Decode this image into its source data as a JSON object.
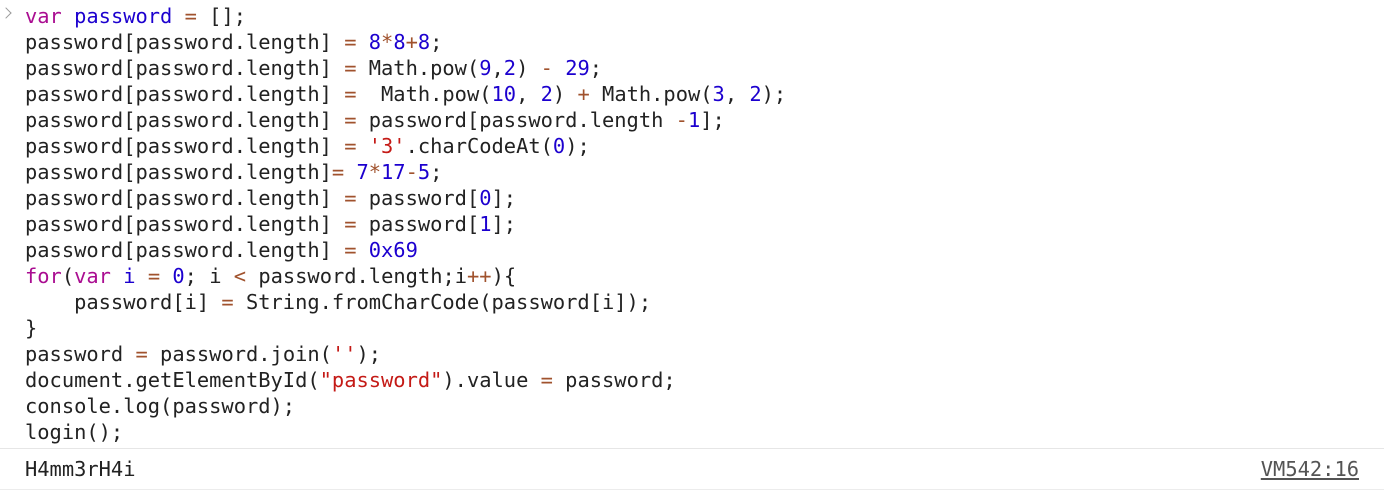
{
  "console": {
    "input": {
      "prompt_icon": "chevron-right-icon",
      "lines": [
        [
          {
            "t": "kw",
            "v": "var"
          },
          {
            "t": "pl",
            "v": " "
          },
          {
            "t": "var",
            "v": "password"
          },
          {
            "t": "pl",
            "v": " "
          },
          {
            "t": "op",
            "v": "="
          },
          {
            "t": "pl",
            "v": " [];"
          }
        ],
        [
          {
            "t": "pl",
            "v": "password[password.length] "
          },
          {
            "t": "op",
            "v": "="
          },
          {
            "t": "pl",
            "v": " "
          },
          {
            "t": "num",
            "v": "8"
          },
          {
            "t": "op",
            "v": "*"
          },
          {
            "t": "num",
            "v": "8"
          },
          {
            "t": "op",
            "v": "+"
          },
          {
            "t": "num",
            "v": "8"
          },
          {
            "t": "pl",
            "v": ";"
          }
        ],
        [
          {
            "t": "pl",
            "v": "password[password.length] "
          },
          {
            "t": "op",
            "v": "="
          },
          {
            "t": "pl",
            "v": " Math.pow("
          },
          {
            "t": "num",
            "v": "9"
          },
          {
            "t": "pl",
            "v": ","
          },
          {
            "t": "num",
            "v": "2"
          },
          {
            "t": "pl",
            "v": ") "
          },
          {
            "t": "op",
            "v": "-"
          },
          {
            "t": "pl",
            "v": " "
          },
          {
            "t": "num",
            "v": "29"
          },
          {
            "t": "pl",
            "v": ";"
          }
        ],
        [
          {
            "t": "pl",
            "v": "password[password.length] "
          },
          {
            "t": "op",
            "v": "="
          },
          {
            "t": "pl",
            "v": "  Math.pow("
          },
          {
            "t": "num",
            "v": "10"
          },
          {
            "t": "pl",
            "v": ", "
          },
          {
            "t": "num",
            "v": "2"
          },
          {
            "t": "pl",
            "v": ") "
          },
          {
            "t": "op",
            "v": "+"
          },
          {
            "t": "pl",
            "v": " Math.pow("
          },
          {
            "t": "num",
            "v": "3"
          },
          {
            "t": "pl",
            "v": ", "
          },
          {
            "t": "num",
            "v": "2"
          },
          {
            "t": "pl",
            "v": ");"
          }
        ],
        [
          {
            "t": "pl",
            "v": "password[password.length] "
          },
          {
            "t": "op",
            "v": "="
          },
          {
            "t": "pl",
            "v": " password[password.length "
          },
          {
            "t": "op",
            "v": "-"
          },
          {
            "t": "num",
            "v": "1"
          },
          {
            "t": "pl",
            "v": "];"
          }
        ],
        [
          {
            "t": "pl",
            "v": "password[password.length] "
          },
          {
            "t": "op",
            "v": "="
          },
          {
            "t": "pl",
            "v": " "
          },
          {
            "t": "str",
            "v": "'3'"
          },
          {
            "t": "pl",
            "v": ".charCodeAt("
          },
          {
            "t": "num",
            "v": "0"
          },
          {
            "t": "pl",
            "v": ");"
          }
        ],
        [
          {
            "t": "pl",
            "v": "password[password.length]"
          },
          {
            "t": "op",
            "v": "="
          },
          {
            "t": "pl",
            "v": " "
          },
          {
            "t": "num",
            "v": "7"
          },
          {
            "t": "op",
            "v": "*"
          },
          {
            "t": "num",
            "v": "17"
          },
          {
            "t": "op",
            "v": "-"
          },
          {
            "t": "num",
            "v": "5"
          },
          {
            "t": "pl",
            "v": ";"
          }
        ],
        [
          {
            "t": "pl",
            "v": "password[password.length] "
          },
          {
            "t": "op",
            "v": "="
          },
          {
            "t": "pl",
            "v": " password["
          },
          {
            "t": "num",
            "v": "0"
          },
          {
            "t": "pl",
            "v": "];"
          }
        ],
        [
          {
            "t": "pl",
            "v": "password[password.length] "
          },
          {
            "t": "op",
            "v": "="
          },
          {
            "t": "pl",
            "v": " password["
          },
          {
            "t": "num",
            "v": "1"
          },
          {
            "t": "pl",
            "v": "];"
          }
        ],
        [
          {
            "t": "pl",
            "v": "password[password.length] "
          },
          {
            "t": "op",
            "v": "="
          },
          {
            "t": "pl",
            "v": " "
          },
          {
            "t": "num",
            "v": "0x69"
          }
        ],
        [
          {
            "t": "kw",
            "v": "for"
          },
          {
            "t": "pl",
            "v": "("
          },
          {
            "t": "kw",
            "v": "var"
          },
          {
            "t": "pl",
            "v": " "
          },
          {
            "t": "var",
            "v": "i"
          },
          {
            "t": "pl",
            "v": " "
          },
          {
            "t": "op",
            "v": "="
          },
          {
            "t": "pl",
            "v": " "
          },
          {
            "t": "num",
            "v": "0"
          },
          {
            "t": "pl",
            "v": "; i "
          },
          {
            "t": "op",
            "v": "<"
          },
          {
            "t": "pl",
            "v": " password.length;i"
          },
          {
            "t": "op",
            "v": "++"
          },
          {
            "t": "pl",
            "v": "){"
          }
        ],
        [
          {
            "t": "pl",
            "v": "    password[i] "
          },
          {
            "t": "op",
            "v": "="
          },
          {
            "t": "pl",
            "v": " String.fromCharCode(password[i]);"
          }
        ],
        [
          {
            "t": "pl",
            "v": "}"
          }
        ],
        [
          {
            "t": "pl",
            "v": "password "
          },
          {
            "t": "op",
            "v": "="
          },
          {
            "t": "pl",
            "v": " password.join("
          },
          {
            "t": "str",
            "v": "''"
          },
          {
            "t": "pl",
            "v": ");"
          }
        ],
        [
          {
            "t": "pl",
            "v": "document.getElementById("
          },
          {
            "t": "str",
            "v": "\"password\""
          },
          {
            "t": "pl",
            "v": ").value "
          },
          {
            "t": "op",
            "v": "="
          },
          {
            "t": "pl",
            "v": " password;"
          }
        ],
        [
          {
            "t": "pl",
            "v": "console.log(password);"
          }
        ],
        [
          {
            "t": "pl",
            "v": "login();"
          }
        ]
      ]
    },
    "output": {
      "text": "H4mm3rH4i",
      "source": "VM542:16"
    }
  },
  "colors": {
    "keyword": "#aa0d91",
    "variable": "#1c00cf",
    "number": "#1c00cf",
    "operator": "#a0522d",
    "string": "#c41a16",
    "plain": "#222222"
  }
}
